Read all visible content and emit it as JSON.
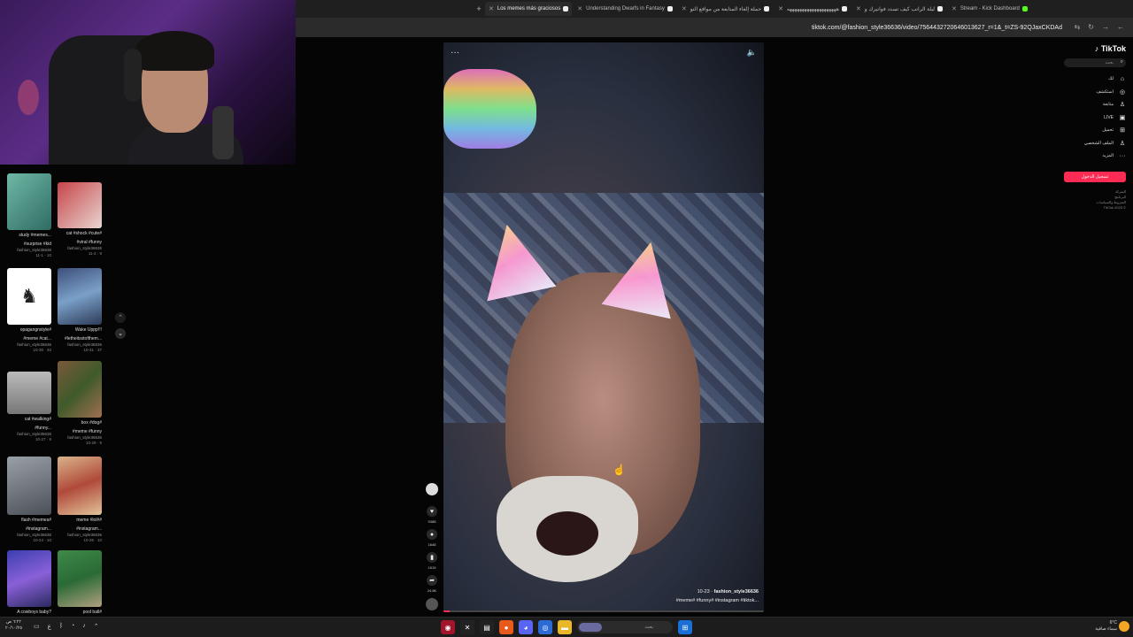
{
  "browser": {
    "new_tab_symbol": "+",
    "tabs": [
      {
        "title": "Los memes más graciosos",
        "active": true,
        "icon": "tiktok"
      },
      {
        "title": "Understanding Dwarfs in Fantasy",
        "active": false,
        "icon": "tiktok"
      },
      {
        "title": "حملة إلغاء المتابعة من مواقع التو",
        "active": false,
        "icon": "tiktok"
      },
      {
        "title": "ههههههههههههههههههههه",
        "active": false,
        "icon": "tiktok"
      },
      {
        "title": "ليلة الراتب كيف تسدد فواتيرك و",
        "active": false,
        "icon": "tiktok"
      },
      {
        "title": "Stream - Kick Dashboard",
        "active": false,
        "icon": "kick"
      }
    ],
    "url": "tiktok.com/@fashion_style36636/video/7564432720646013627_r=1&_t=ZS-92QJaxCKDAd"
  },
  "grid": {
    "items": [
      {
        "title": "study #memes...",
        "subtitle": "#surprise #kid",
        "user": "fashion_style36636",
        "meta": "11-1 · 10"
      },
      {
        "title": "cat #shock #cute#",
        "subtitle": "#viral #funny",
        "user": "fashion_style36636",
        "meta": "11-2 · 9"
      },
      {
        "title": "opagangnstyle#",
        "subtitle": "#meme #cat...",
        "user": "fashion_style36636",
        "meta": "10-30 · 40"
      },
      {
        "title": "Wake Uppp!!!",
        "subtitle": "#letheitsstofthem...",
        "user": "fashion_style36636",
        "meta": "10-31 · 37"
      },
      {
        "title": "cat #walking#",
        "subtitle": "#funny...",
        "user": "fashion_style36636",
        "meta": "10-27 · 9"
      },
      {
        "title": "box #dog#",
        "subtitle": "#meme #funny",
        "user": "fashion_style36636",
        "meta": "10-29 · 9"
      },
      {
        "title": "flash #memes#",
        "subtitle": "#instagram...",
        "user": "fashion_style36636",
        "meta": "10-24 · 10"
      },
      {
        "title": "meme #lol##",
        "subtitle": "#instagram...",
        "user": "fashion_style36636",
        "meta": "10-26 · 10"
      },
      {
        "title": "A cowboys baby?",
        "subtitle": "",
        "user": "",
        "meta": ""
      },
      {
        "title": "pool ball#",
        "subtitle": "",
        "user": "",
        "meta": ""
      }
    ],
    "up_symbol": "⌃",
    "down_symbol": "⌄"
  },
  "video": {
    "menu_symbol": "···",
    "volume_symbol": "🔈",
    "date": "10-23",
    "author": "fashion_style36636",
    "caption": "#meme# #funny# #instagram #tiktok...",
    "progress_fraction": 0.02
  },
  "actions": {
    "likes": "9388",
    "comments": "1648",
    "saves": "1619",
    "shares": "24.8K"
  },
  "sidebar": {
    "logo": "TikTok",
    "search_placeholder": "بحث",
    "nav": [
      {
        "label": "لك",
        "icon": "home-icon",
        "glyph": "⌂"
      },
      {
        "label": "استكشف",
        "icon": "compass-icon",
        "glyph": "◎"
      },
      {
        "label": "متابعة",
        "icon": "following-icon",
        "glyph": "♙"
      },
      {
        "label": "LIVE",
        "icon": "live-icon",
        "glyph": "▣"
      },
      {
        "label": "تحميل",
        "icon": "upload-icon",
        "glyph": "⊞"
      },
      {
        "label": "الملف الشخصي",
        "icon": "profile-icon",
        "glyph": "♙"
      },
      {
        "label": "المزيد",
        "icon": "more-icon",
        "glyph": "···"
      }
    ],
    "login_label": "تسجيل الدخول",
    "footer": [
      "الشركة",
      "البرنامج",
      "الشروط والسياسات",
      "TikTok 2025 ©"
    ]
  },
  "taskbar": {
    "time": "٦:٢٢ ص",
    "date": "٢٠/١٠/٢٥",
    "lang": "ع",
    "search_placeholder": "بحث",
    "weather_temp": "6°C",
    "weather_desc": "سماء صافية"
  },
  "colors": {
    "accent": "#fe2c55",
    "kick": "#53fc18"
  }
}
